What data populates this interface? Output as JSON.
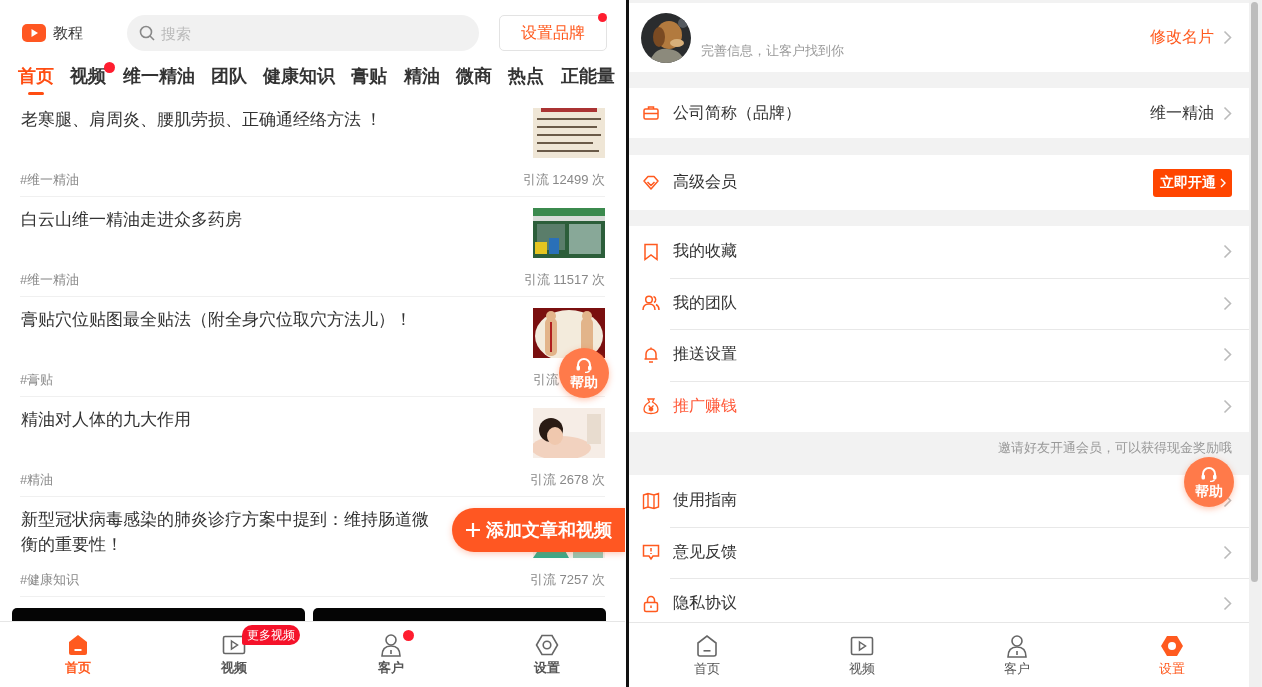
{
  "left": {
    "logo_label": "教程",
    "search": {
      "placeholder": "搜索"
    },
    "brand_button": {
      "label": "设置品牌",
      "dot": true
    },
    "tabs": [
      {
        "label": "首页",
        "selected": true,
        "dot": false
      },
      {
        "label": "视频",
        "selected": false,
        "dot": true
      },
      {
        "label": "维一精油",
        "selected": false,
        "dot": false
      },
      {
        "label": "团队",
        "selected": false,
        "dot": false
      },
      {
        "label": "健康知识",
        "selected": false,
        "dot": false
      },
      {
        "label": "膏贴",
        "selected": false,
        "dot": false
      },
      {
        "label": "精油",
        "selected": false,
        "dot": false
      },
      {
        "label": "微商",
        "selected": false,
        "dot": false
      },
      {
        "label": "热点",
        "selected": false,
        "dot": false
      },
      {
        "label": "正能量",
        "selected": false,
        "dot": false
      }
    ],
    "articles": [
      {
        "title": "老寒腿、肩周炎、腰肌劳损、正确通经络方法 ！",
        "tag": "#维一精油",
        "stats": "引流 12499 次"
      },
      {
        "title": "白云山维一精油走进众多药房",
        "tag": "#维一精油",
        "stats": "引流 11517 次"
      },
      {
        "title": "膏贴穴位贴图最全贴法（附全身穴位取穴方法儿）！",
        "tag": "#膏贴",
        "stats": "引流"
      },
      {
        "title": "精油对人体的九大作用",
        "tag": "#精油",
        "stats": "引流 2678 次"
      },
      {
        "title": "新型冠状病毒感染的肺炎诊疗方案中提到：维持肠道微",
        "title_continued": "衡的重要性！",
        "tag": "#健康知识",
        "stats": "引流 7257 次"
      }
    ],
    "video_cards": [
      {
        "kind": "video"
      },
      {
        "kind": "video"
      }
    ],
    "add_button": {
      "label": "添加文章和视频"
    },
    "help_button": {
      "label": "帮助"
    },
    "nav": [
      {
        "label": "首页",
        "selected": true,
        "dot": false
      },
      {
        "label": "视频",
        "selected": false,
        "dot": false,
        "badge": "更多视频"
      },
      {
        "label": "客户",
        "selected": false,
        "dot": true
      },
      {
        "label": "设置",
        "selected": false,
        "dot": false
      }
    ]
  },
  "right": {
    "profile": {
      "subtitle": "完善信息，让客户找到你",
      "edit_link": "修改名片"
    },
    "company": {
      "label": "公司简称（品牌）",
      "value": "维一精油"
    },
    "membership": {
      "label": "高级会员",
      "button": "立即开通"
    },
    "menu": [
      {
        "label": "我的收藏",
        "highlighted": false
      },
      {
        "label": "我的团队",
        "highlighted": false
      },
      {
        "label": "推送设置",
        "highlighted": false
      },
      {
        "label": "推广赚钱",
        "highlighted": true
      }
    ],
    "invite_hint": "邀请好友开通会员，可以获得现金奖励哦",
    "help_menu": [
      {
        "label": "使用指南"
      },
      {
        "label": "意见反馈"
      },
      {
        "label": "隐私协议"
      }
    ],
    "help_button": {
      "label": "帮助"
    },
    "nav": [
      {
        "label": "首页",
        "selected": false,
        "dot": false
      },
      {
        "label": "视频",
        "selected": false,
        "dot": false
      },
      {
        "label": "客户",
        "selected": false,
        "dot": false
      },
      {
        "label": "设置",
        "selected": true,
        "dot": false
      }
    ]
  }
}
